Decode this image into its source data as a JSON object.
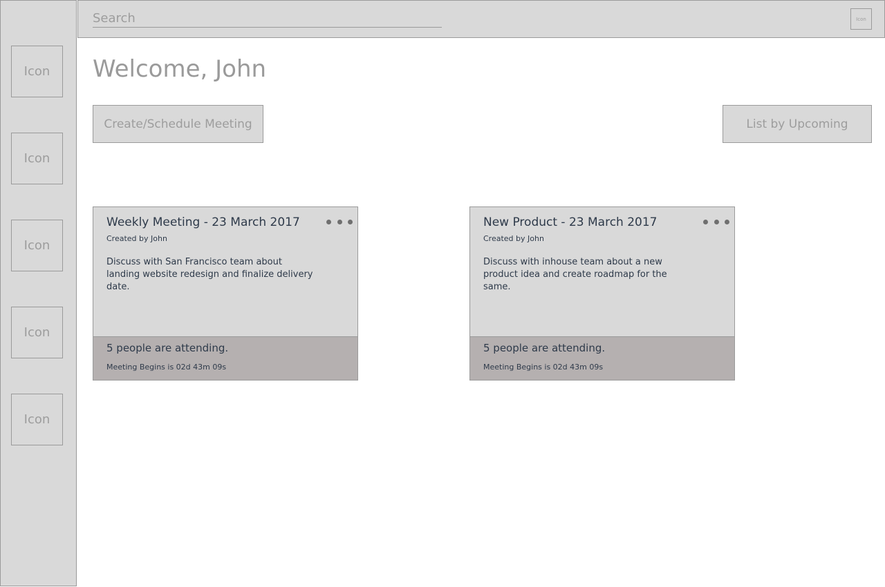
{
  "sidebar": {
    "items": [
      {
        "label": "Icon"
      },
      {
        "label": "Icon"
      },
      {
        "label": "Icon"
      },
      {
        "label": "Icon"
      },
      {
        "label": "Icon"
      }
    ]
  },
  "header": {
    "search_placeholder": "Search",
    "icon_label": "Icon"
  },
  "main": {
    "title": "Welcome, John",
    "create_button": "Create/Schedule Meeting",
    "list_button": "List by Upcoming",
    "cards": [
      {
        "title": "Weekly Meeting - 23 March 2017",
        "author": "Created by John",
        "description": "Discuss with San Francisco team about landing website redesign and finalize delivery date.",
        "attending": "5 people are attending.",
        "countdown": "Meeting Begins is 02d 43m 09s"
      },
      {
        "title": "New Product  - 23 March 2017",
        "author": "Created by John",
        "description": "Discuss with inhouse team about a new product idea and create roadmap for the same.",
        "attending": "5 people are attending.",
        "countdown": "Meeting Begins is 02d 43m 09s"
      }
    ]
  },
  "colors": {
    "panel": "#d9d9d9",
    "border": "#9a9a9a",
    "card_footer": "#b5b0b0",
    "card_text": "#2e3a4a",
    "muted_text": "#9d9d9d"
  }
}
